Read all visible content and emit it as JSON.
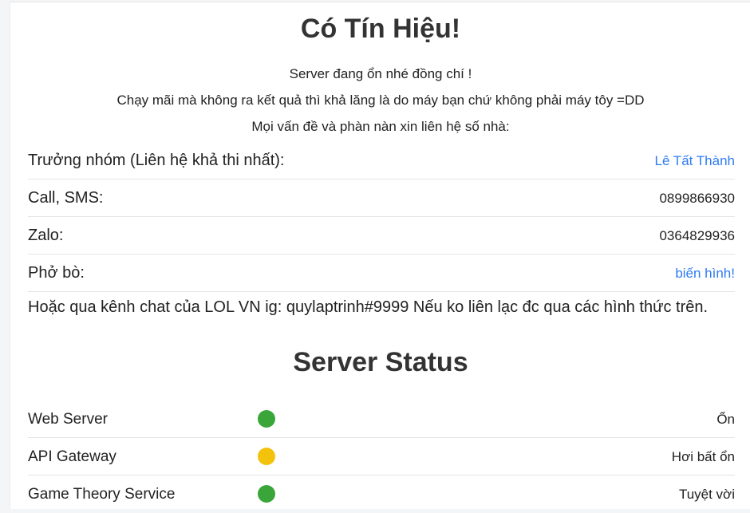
{
  "header": {
    "title": "Có Tín Hiệu!",
    "messages": [
      "Server đang ổn nhé đồng chí !",
      "Chạy mãi mà không ra kết quả thì khả lăng là do máy bạn chứ không phải máy tôy =DD",
      "Mọi vấn đề và phàn nàn xin liên hệ số nhà:"
    ]
  },
  "contacts": [
    {
      "label": "Trưởng nhóm (Liên hệ khả thi nhất):",
      "value": "Lê Tất Thành"
    },
    {
      "label": "Call, SMS:",
      "value": "0899866930"
    },
    {
      "label": "Zalo:",
      "value": "0364829936"
    },
    {
      "label": "Phở bò:",
      "value": "biến hình!"
    }
  ],
  "other_channel": "Hoặc qua kênh chat của LOL VN ig: quylaptrinh#9999 Nếu ko liên lạc đc qua các hình thức trên.",
  "status": {
    "title": "Server Status",
    "services": [
      {
        "name": "Web Server",
        "state": "Ổn",
        "color": "#3aa63a"
      },
      {
        "name": "API Gateway",
        "state": "Hơi bất ổn",
        "color": "#f2c20c"
      },
      {
        "name": "Game Theory Service",
        "state": "Tuyệt vời",
        "color": "#3aa63a"
      }
    ]
  },
  "colors": {
    "link": "#2f7bf5",
    "ok": "#3aa63a",
    "warn": "#f2c20c"
  }
}
